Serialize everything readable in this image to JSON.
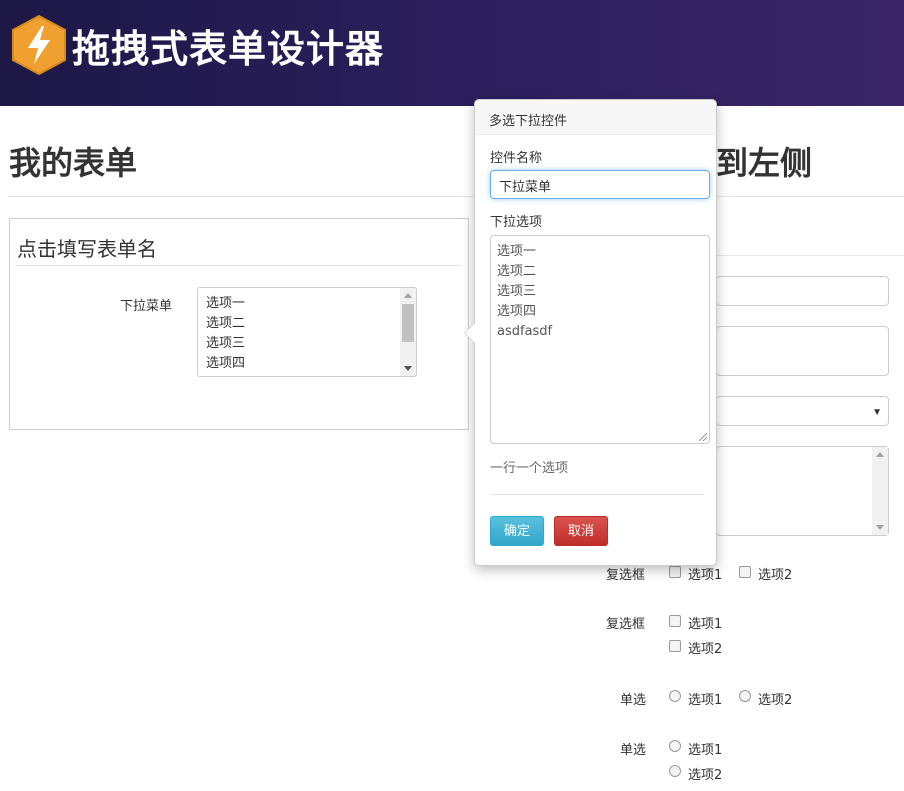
{
  "header": {
    "title": "拖拽式表单设计器"
  },
  "left": {
    "heading": "我的表单",
    "form_name": "点击填写表单名",
    "field_label": "下拉菜单",
    "listbox_options": [
      "选项一",
      "选项二",
      "选项三",
      "选项四"
    ]
  },
  "right": {
    "heading": "到左侧",
    "checkbox_row1": {
      "label": "复选框",
      "options": [
        "选项1",
        "选项2"
      ]
    },
    "checkbox_row2": {
      "label": "复选框",
      "options": [
        "选项1",
        "选项2"
      ]
    },
    "radio_row1": {
      "label": "单选",
      "options": [
        "选项1",
        "选项2"
      ]
    },
    "radio_row2": {
      "label": "单选",
      "options": [
        "选项1",
        "选项2"
      ]
    }
  },
  "popover": {
    "title": "多选下拉控件",
    "name_label": "控件名称",
    "name_value": "下拉菜单",
    "options_label": "下拉选项",
    "options_lines": [
      "选项一",
      "选项二",
      "选项三",
      "选项四",
      "asdfasdf"
    ],
    "hint": "一行一个选项",
    "ok_label": "确定",
    "cancel_label": "取消"
  },
  "colors": {
    "header_gradient_start": "#1d1846",
    "header_gradient_end": "#3a2668",
    "logo": "#f0a030",
    "ok_button": "#31a6c8",
    "cancel_button": "#c12e2a"
  }
}
